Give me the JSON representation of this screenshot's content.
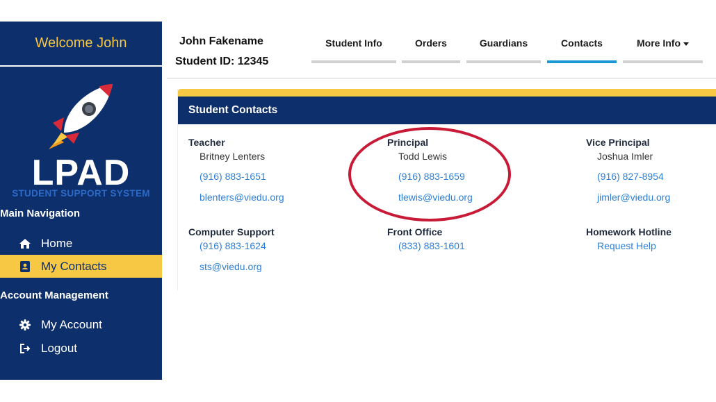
{
  "sidebar": {
    "welcome": "Welcome John",
    "logo": {
      "main": "LPAD",
      "tagline": "STUDENT SUPPORT SYSTEM"
    },
    "sections": [
      {
        "label": "Main Navigation"
      },
      {
        "label": "Account Management"
      }
    ],
    "items": [
      {
        "label": "Home",
        "icon": "home-icon"
      },
      {
        "label": "My Contacts",
        "icon": "contact-card-icon",
        "active": true
      },
      {
        "label": "My Account",
        "icon": "gear-icon"
      },
      {
        "label": "Logout",
        "icon": "logout-icon"
      }
    ]
  },
  "student": {
    "name": "John Fakename",
    "id": "Student ID: 12345"
  },
  "tabs": [
    {
      "label": "Student Info"
    },
    {
      "label": "Orders"
    },
    {
      "label": "Guardians"
    },
    {
      "label": "Contacts",
      "active": true
    },
    {
      "label": "More Info"
    }
  ],
  "card": {
    "title": "Student Contacts",
    "contacts": [
      {
        "role": "Teacher",
        "name": "Britney Lenters",
        "phone": "(916) 883-1651",
        "email": "blenters@viedu.org"
      },
      {
        "role": "Principal",
        "name": "Todd Lewis",
        "phone": "(916) 883-1659",
        "email": "tlewis@viedu.org"
      },
      {
        "role": "Vice Principal",
        "name": "Joshua Imler",
        "phone": "(916) 827-8954",
        "email": "jimler@viedu.org"
      },
      {
        "role": "Computer Support",
        "phone": "(916) 883-1624",
        "email": "sts@viedu.org"
      },
      {
        "role": "Front Office",
        "phone": "(833) 883-1601"
      },
      {
        "role": "Homework Hotline",
        "link": "Request Help"
      }
    ]
  },
  "colors": {
    "navy": "#0d2f6b",
    "yellow": "#f6c844",
    "link": "#2c7fd6",
    "highlight": "#c81a37",
    "active_tab": "#1b97d4"
  }
}
